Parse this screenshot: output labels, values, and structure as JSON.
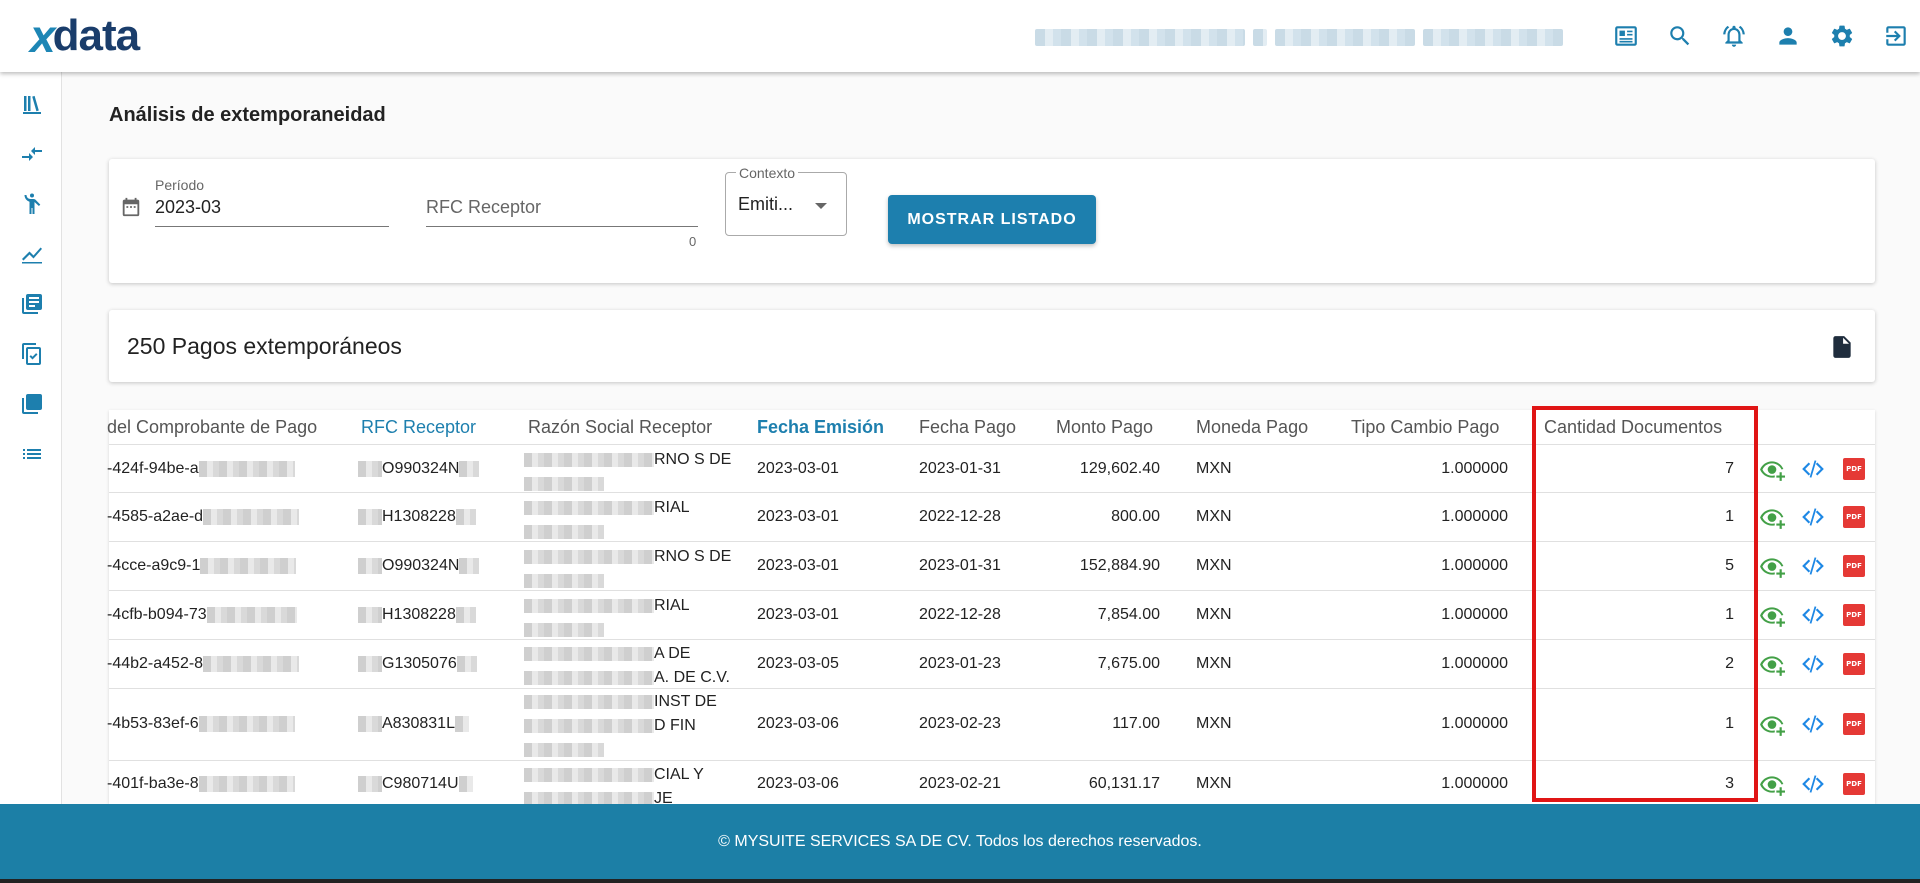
{
  "header": {
    "logo_x": "x",
    "logo_rest": "data",
    "icons": [
      "news-icon",
      "search-icon",
      "notifications-icon",
      "user-icon",
      "settings-icon",
      "logout-icon"
    ]
  },
  "sidebar": {
    "items": [
      "library-icon",
      "compare-arrows-icon",
      "person-icon",
      "chart-line-icon",
      "document-list-icon",
      "copy-check-icon",
      "collections-icon",
      "list-icon"
    ]
  },
  "page": {
    "title": "Análisis de extemporaneidad"
  },
  "filters": {
    "periodo_label": "Período",
    "periodo_value": "2023-03",
    "rfc_label": "RFC Receptor",
    "rfc_counter": "0",
    "contexto_label": "Contexto",
    "contexto_value": "Emiti...",
    "show_button": "MOSTRAR LISTADO"
  },
  "summary": {
    "text": "250 Pagos extemporáneos"
  },
  "table": {
    "headers": {
      "uuid": "del Comprobante de Pago",
      "rfc": "RFC Receptor",
      "razon": "Razón Social Receptor",
      "fecha_emision": "Fecha Emisión",
      "fecha_pago": "Fecha Pago",
      "monto": "Monto Pago",
      "moneda": "Moneda Pago",
      "tipo_cambio": "Tipo Cambio Pago",
      "cantidad": "Cantidad Documentos"
    },
    "rows": [
      {
        "uuid": "-424f-94be-a",
        "rfc": "O990324N",
        "razon1": "RNO S DE",
        "razon2": "",
        "fecha_emision": "2023-03-01",
        "fecha_pago": "2023-01-31",
        "monto": "129,602.40",
        "moneda": "MXN",
        "tipo_cambio": "1.000000",
        "cantidad": "7"
      },
      {
        "uuid": "-4585-a2ae-d",
        "rfc": "H1308228",
        "razon1": "RIAL",
        "razon2": "",
        "fecha_emision": "2023-03-01",
        "fecha_pago": "2022-12-28",
        "monto": "800.00",
        "moneda": "MXN",
        "tipo_cambio": "1.000000",
        "cantidad": "1"
      },
      {
        "uuid": "-4cce-a9c9-1",
        "rfc": "O990324N",
        "razon1": "RNO S DE",
        "razon2": "",
        "fecha_emision": "2023-03-01",
        "fecha_pago": "2023-01-31",
        "monto": "152,884.90",
        "moneda": "MXN",
        "tipo_cambio": "1.000000",
        "cantidad": "5"
      },
      {
        "uuid": "-4cfb-b094-73",
        "rfc": "H1308228",
        "razon1": "RIAL",
        "razon2": "",
        "fecha_emision": "2023-03-01",
        "fecha_pago": "2022-12-28",
        "monto": "7,854.00",
        "moneda": "MXN",
        "tipo_cambio": "1.000000",
        "cantidad": "1"
      },
      {
        "uuid": "-44b2-a452-8",
        "rfc": "G1305076",
        "razon1": "A DE",
        "razon2": "A. DE C.V.",
        "fecha_emision": "2023-03-05",
        "fecha_pago": "2023-01-23",
        "monto": "7,675.00",
        "moneda": "MXN",
        "tipo_cambio": "1.000000",
        "cantidad": "2"
      },
      {
        "uuid": "-4b53-83ef-6",
        "rfc": "A830831L",
        "razon1": "INST DE",
        "razon2": "D FIN",
        "fecha_emision": "2023-03-06",
        "fecha_pago": "2023-02-23",
        "monto": "117.00",
        "moneda": "MXN",
        "tipo_cambio": "1.000000",
        "cantidad": "1"
      },
      {
        "uuid": "-401f-ba3e-8",
        "rfc": "C980714U",
        "razon1": "CIAL Y",
        "razon2": "JE",
        "fecha_emision": "2023-03-06",
        "fecha_pago": "2023-02-21",
        "monto": "60,131.17",
        "moneda": "MXN",
        "tipo_cambio": "1.000000",
        "cantidad": "3"
      }
    ],
    "row_actions": [
      "view-add-icon",
      "code-icon",
      "pdf-icon"
    ],
    "pdf_label": "PDF"
  },
  "footer": {
    "text": "© MYSUITE SERVICES SA DE CV. Todos los derechos reservados."
  },
  "colors": {
    "primary": "#1d7fae",
    "footer": "#1c7fa6",
    "highlight": "#e01515",
    "view_icon": "#43a047",
    "code_icon": "#1e88e5",
    "pdf_icon": "#e53935"
  }
}
